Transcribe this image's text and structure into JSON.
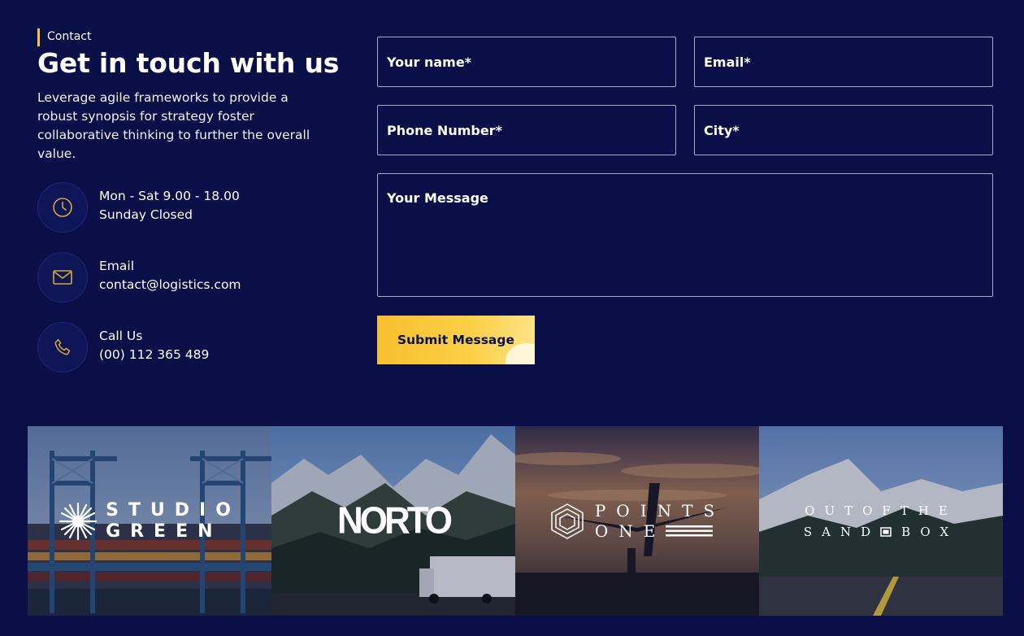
{
  "contact": {
    "eyebrow": "Contact",
    "title": "Get in touch with us",
    "description": "Leverage agile frameworks to provide a robust synopsis for strategy foster collaborative thinking to further the overall value."
  },
  "info": [
    {
      "icon": "clock-icon",
      "line1": "Mon - Sat 9.00 - 18.00",
      "line2": "Sunday Closed"
    },
    {
      "icon": "mail-icon",
      "line1": "Email",
      "line2": "contact@logistics.com"
    },
    {
      "icon": "phone-icon",
      "line1": "Call Us",
      "line2": "(00) 112 365 489"
    }
  ],
  "form": {
    "name_placeholder": "Your name*",
    "email_placeholder": "Email*",
    "phone_placeholder": "Phone Number*",
    "city_placeholder": "City*",
    "message_placeholder": "Your Message",
    "submit_label": "Submit Message"
  },
  "partners": [
    {
      "line1": "STUDIO",
      "line2": "GREEN"
    },
    {
      "line1": "NORTO"
    },
    {
      "line1": "POINTS",
      "line2": "ONE"
    },
    {
      "line1": "OUTOFTHE",
      "line2": "SAND",
      "line3": "BOX"
    }
  ],
  "colors": {
    "background": "#0a0f47",
    "accent": "#f7c33c",
    "icon_bg": "#0f1658",
    "border": "#a7abc9"
  }
}
